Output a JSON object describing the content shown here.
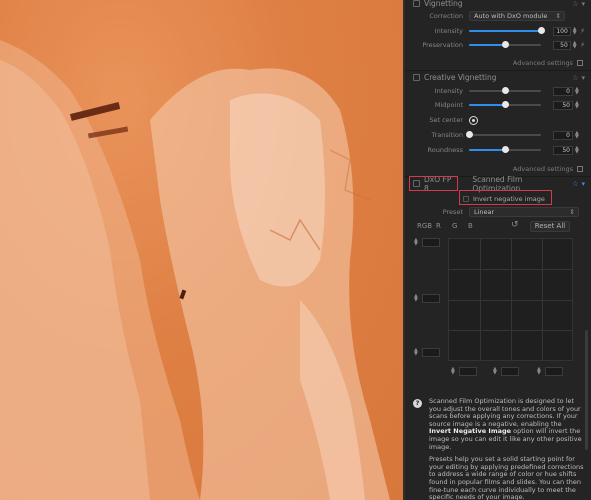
{
  "vignetting": {
    "title": "Vignetting",
    "correction_label": "Correction",
    "correction_value": "Auto with DxO module",
    "intensity_label": "Intensity",
    "intensity_value": "100",
    "intensity_level": 1.0,
    "preservation_label": "Preservation",
    "preservation_value": "50",
    "preservation_level": 0.5,
    "advanced_label": "Advanced settings"
  },
  "creative_vignetting": {
    "title": "Creative Vignetting",
    "intensity_label": "Intensity",
    "intensity_value": "0",
    "intensity_level": 0.5,
    "midpoint_label": "Midpoint",
    "midpoint_value": "50",
    "midpoint_level": 0.5,
    "set_center_label": "Set center",
    "transition_label": "Transition",
    "transition_value": "0",
    "transition_level": 0.0,
    "roundness_label": "Roundness",
    "roundness_value": "50",
    "roundness_level": 0.5,
    "advanced_label": "Advanced settings"
  },
  "film": {
    "badge": "DxO FP 8",
    "title": "Scanned Film Optimization",
    "invert_label": "Invert negative image",
    "preset_label": "Preset",
    "preset_value": "Linear",
    "channels": [
      "RGB",
      "R",
      "G",
      "B"
    ],
    "reset_label": "Reset All"
  },
  "help": {
    "p1_a": "Scanned Film Optimization",
    "p1_b": " is designed to let you adjust the overall tones and colors of your scans before applying any corrections. If your source image is a negative, enabling the ",
    "p1_c": "Invert Negative Image",
    "p1_d": " option will invert the image so you can edit it like any other positive image.",
    "p2": "Presets help you set a solid starting point for your editing by applying predefined corrections to address a wide range of color or hue shifts found in popular films and slides. You can then fine-tune each curve individually to meet the specific needs of your image."
  },
  "colors": {
    "accent": "#2f8fe8",
    "highlight_box": "#d43a4a",
    "photo": "#de7f44"
  }
}
